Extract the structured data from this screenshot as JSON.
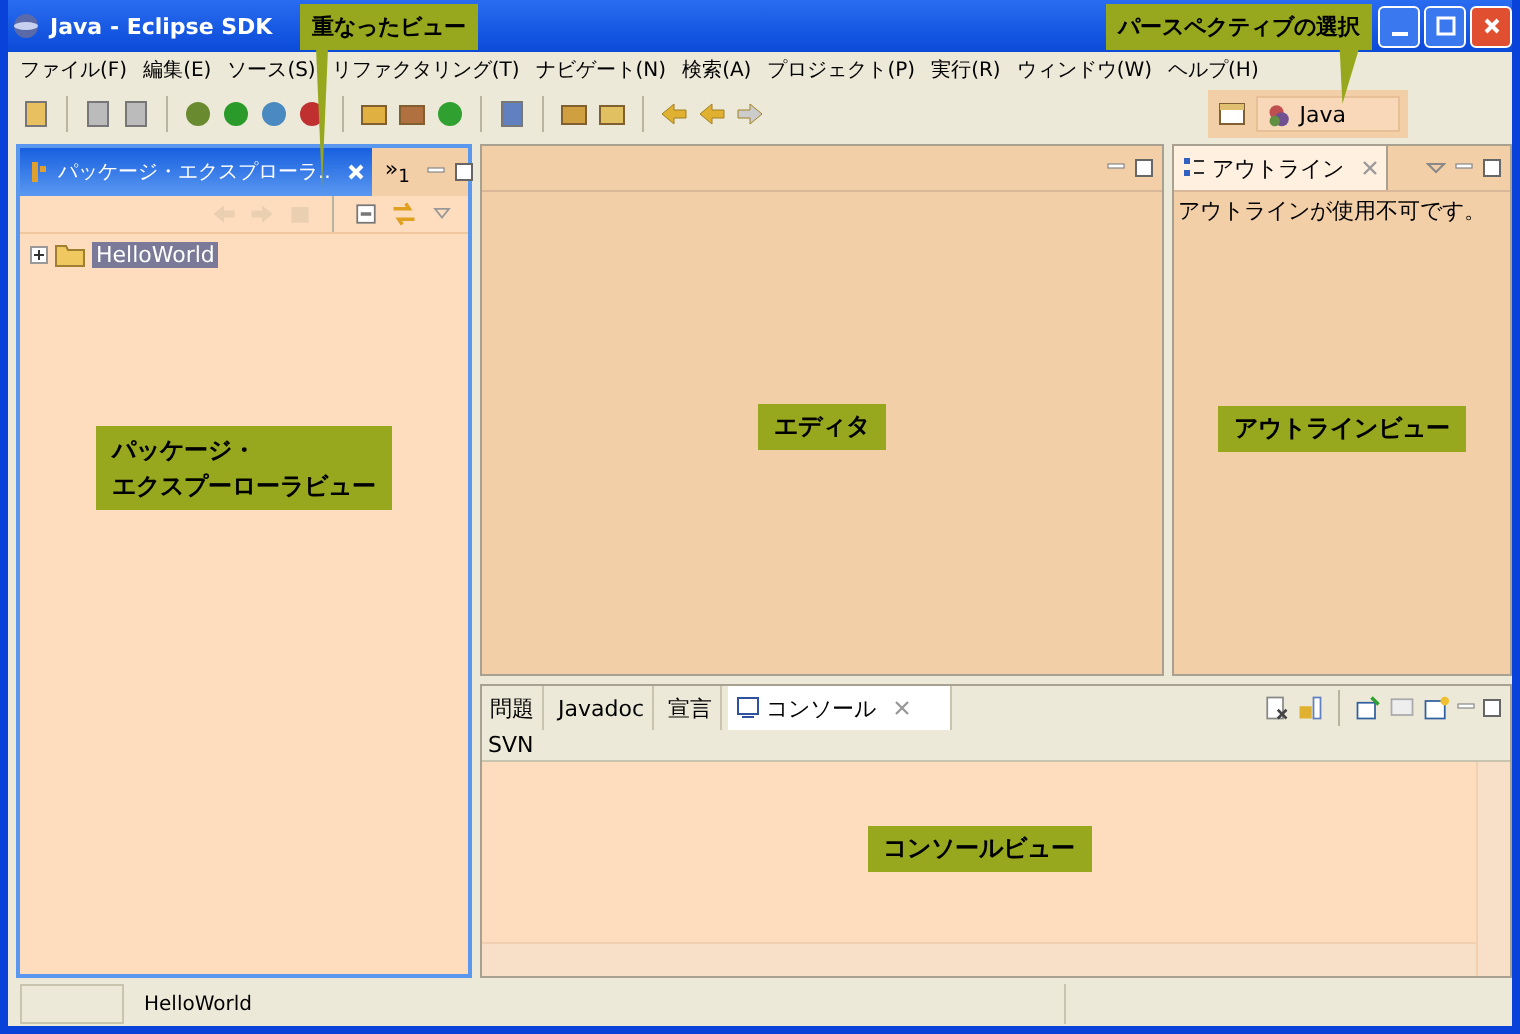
{
  "window": {
    "title": "Java - Eclipse SDK"
  },
  "menu": [
    "ファイル(F)",
    "編集(E)",
    "ソース(S)",
    "リファクタリング(T)",
    "ナビゲート(N)",
    "検索(A)",
    "プロジェクト(P)",
    "実行(R)",
    "ウィンドウ(W)",
    "ヘルプ(H)"
  ],
  "perspective": {
    "label": "Java",
    "selected": true
  },
  "package_explorer": {
    "tab": "パッケージ・エクスプローラ..",
    "active": true,
    "overflow": "»$_{1}$",
    "tree": [
      {
        "label": "HelloWorld",
        "selected": true,
        "expanded": false
      }
    ],
    "annotation": [
      "パッケージ・",
      "エクスプーローラビュー"
    ]
  },
  "editor": {
    "annotation": "エディタ"
  },
  "outline": {
    "tab": "アウトライン",
    "message": "アウトラインが使用不可です。",
    "annotation": "アウトラインビュー"
  },
  "console": {
    "tabs": [
      {
        "label": "問題",
        "selected": false
      },
      {
        "label": "Javadoc",
        "selected": false
      },
      {
        "label": "宣言",
        "selected": false
      },
      {
        "label": "コンソール",
        "selected": true
      }
    ],
    "header": "SVN",
    "annotation": "コンソールビュー"
  },
  "status_bar": {
    "text": "HelloWorld"
  },
  "callouts": [
    {
      "text": "重なったビュー"
    },
    {
      "text": "パースペクティブの選択"
    }
  ]
}
